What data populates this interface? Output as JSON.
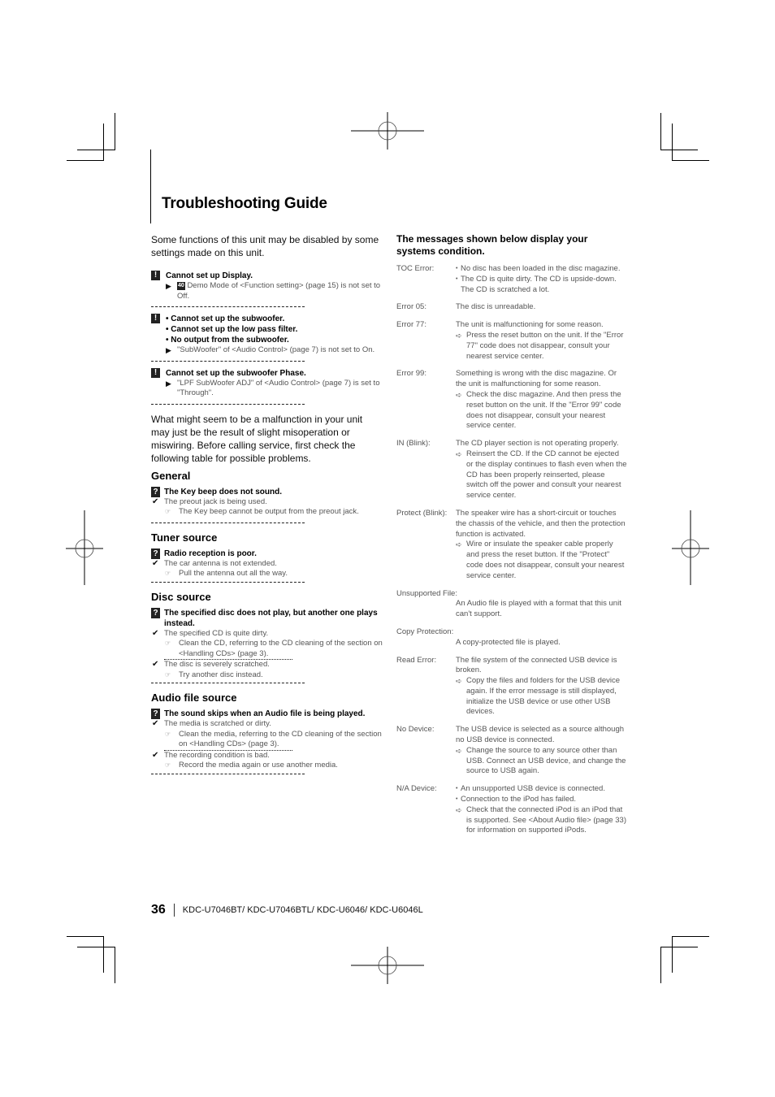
{
  "page": {
    "title": "Troubleshooting Guide",
    "page_number": "36",
    "models": "KDC-U7046BT/ KDC-U7046BTL/ KDC-U6046/ KDC-U6046L"
  },
  "left": {
    "intro": "Some functions of this unit may be disabled by some settings made on this unit.",
    "notes": [
      {
        "icon": "!",
        "titles": [
          "Cannot set up Display."
        ],
        "badge": "40",
        "body": "Demo Mode of <Function setting> (page 15) is not set to Off."
      },
      {
        "icon": "!",
        "titles": [
          "• Cannot set up the subwoofer.",
          "• Cannot set up the low pass filter.",
          "• No output from the subwoofer."
        ],
        "body": "\"SubWoofer\" of <Audio Control> (page 7) is not set to On."
      },
      {
        "icon": "!",
        "titles": [
          "Cannot set up the subwoofer Phase."
        ],
        "body": "\"LPF SubWoofer ADJ\" of <Audio Control> (page 7) is set to \"Through\"."
      }
    ],
    "paragraph": "What might seem to be a malfunction in your unit may just be the result of slight misoperation or miswiring. Before calling service, first check the following table for possible problems.",
    "sections": [
      {
        "heading": "General",
        "problem": "The Key beep does not sound.",
        "causes": [
          {
            "cause": "The preout jack is being used.",
            "remedy": "The Key beep cannot be output from the preout jack."
          }
        ]
      },
      {
        "heading": "Tuner source",
        "problem": "Radio reception is poor.",
        "causes": [
          {
            "cause": "The car antenna is not extended.",
            "remedy": "Pull the antenna out all the way."
          }
        ]
      },
      {
        "heading": "Disc source",
        "problem": "The specified disc does not play, but another one plays instead.",
        "causes": [
          {
            "cause": "The specified CD is quite dirty.",
            "remedy": "Clean the CD, referring to the CD cleaning of the section on <Handling CDs> (page 3)."
          },
          {
            "cause": "The disc is severely scratched.",
            "remedy": "Try another disc instead."
          }
        ]
      },
      {
        "heading": "Audio file source",
        "problem": "The sound skips when an Audio file is being played.",
        "causes": [
          {
            "cause": "The media is scratched or dirty.",
            "remedy": "Clean the media, referring to the CD cleaning of the section on <Handling CDs> (page 3)."
          },
          {
            "cause": "The recording condition is bad.",
            "remedy": "Record the media again or use another media."
          }
        ]
      }
    ]
  },
  "right": {
    "heading": "The messages shown below display your systems condition.",
    "messages": [
      {
        "code": "TOC Error:",
        "bullets": [
          "No disc has been loaded in the disc magazine.",
          "The CD is quite dirty. The CD is upside-down. The CD is scratched a lot."
        ]
      },
      {
        "code": "Error 05:",
        "desc": "The disc is unreadable."
      },
      {
        "code": "Error 77:",
        "desc": "The unit is malfunctioning for some reason.",
        "action": "Press the reset button on the unit. If the \"Error 77\" code does not disappear, consult your nearest service center."
      },
      {
        "code": "Error 99:",
        "desc": "Something is wrong with the disc magazine. Or the unit is malfunctioning for some reason.",
        "action": "Check the disc magazine. And then press the reset button on the unit. If the \"Error 99\" code does not disappear, consult your nearest service center."
      },
      {
        "code": "IN (Blink):",
        "desc": "The CD player section is not operating properly.",
        "action": "Reinsert the CD. If the CD cannot be ejected or the display continues to flash even when the CD has been properly reinserted, please switch off the power and consult your nearest service center."
      },
      {
        "code": "Protect (Blink):",
        "desc": "The speaker wire has a short-circuit or touches the chassis of the vehicle, and then the protection function is activated.",
        "action": "Wire or insulate the speaker cable properly and press the reset button. If the \"Protect\" code does not disappear, consult your nearest service center."
      },
      {
        "code": "Unsupported File:",
        "desc": "An Audio file is played with a format that this unit can't support."
      },
      {
        "code": "Copy Protection:",
        "desc": "A copy-protected file is played."
      },
      {
        "code": "Read Error:",
        "desc": "The file system of the connected USB device is broken.",
        "action": "Copy the files and folders for the USB device again. If the error message is still displayed, initialize the USB device or use other USB devices."
      },
      {
        "code": "No Device:",
        "desc": "The USB device is selected as a source although no USB device is connected.",
        "action": "Change the source to any source other than USB. Connect an USB device, and change the source to USB again."
      },
      {
        "code": "N/A Device:",
        "bullets": [
          "An unsupported USB device is connected.",
          "Connection to the iPod has failed."
        ],
        "action": "Check that the connected iPod is an iPod that is supported. See <About Audio file> (page 33) for information on supported iPods."
      }
    ]
  },
  "icons": {
    "arrow": "▶",
    "check": "✔",
    "hand": "☞",
    "forward": "➪"
  }
}
